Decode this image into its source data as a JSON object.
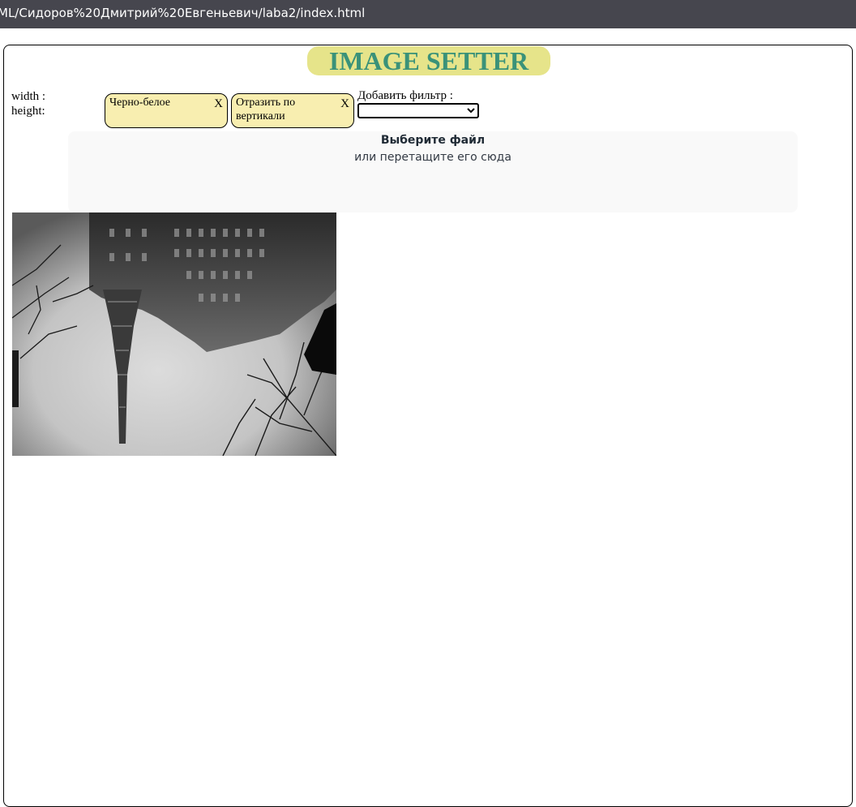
{
  "browser": {
    "url": "ML/Сидоров%20Дмитрий%20Евгеньевич/laba2/index.html"
  },
  "app": {
    "title": "IMAGE SETTER",
    "title_color": "#3a9279",
    "title_bg": "#e6e48a"
  },
  "dimensions": {
    "width_label": "width :",
    "height_label": "height:"
  },
  "filters": {
    "active": [
      {
        "label": "Черно-белое",
        "close": "X"
      },
      {
        "label": "Отразить по вертикали",
        "close": "X"
      }
    ],
    "chip_bg": "#f8eeb0",
    "add_label": "Добавить фильтр :",
    "select_value": ""
  },
  "dropzone": {
    "choose_label": "Выберите файл",
    "drag_label": "или перетащите его сюда"
  },
  "preview": {
    "icon": "image-preview",
    "description_hidden": true
  }
}
